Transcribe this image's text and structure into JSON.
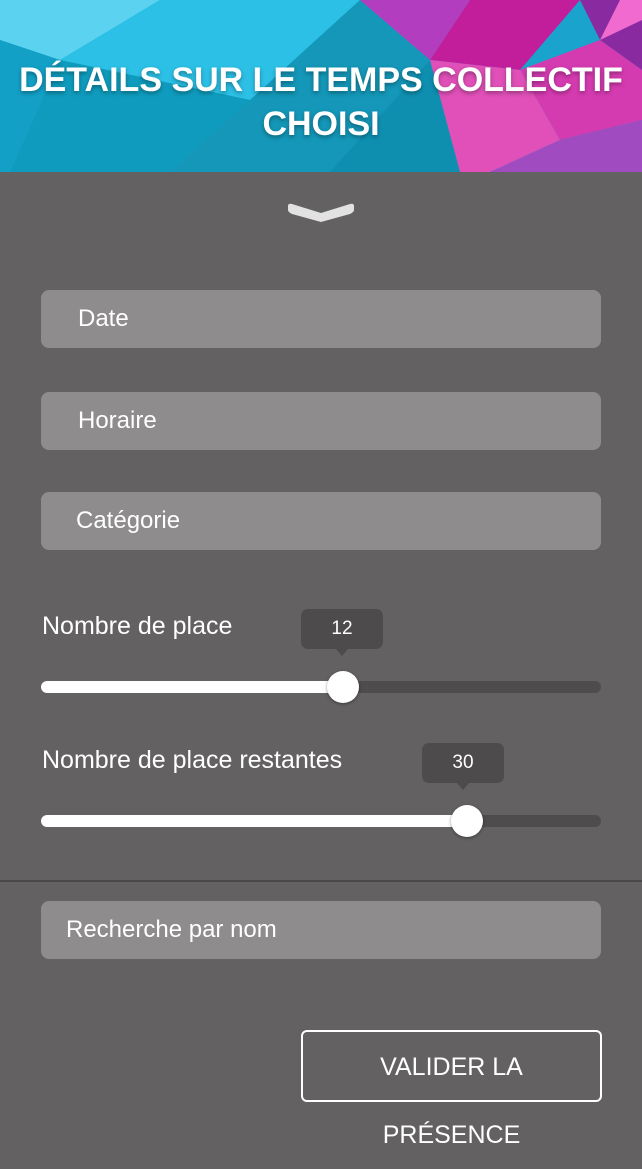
{
  "header": {
    "title_line1": "DÉTAILS SUR LE TEMPS COLLECTIF",
    "title_line2": "CHOISI"
  },
  "form": {
    "date_placeholder": "Date",
    "horaire_placeholder": "Horaire",
    "categorie_placeholder": "Catégorie",
    "search_placeholder": "Recherche par nom"
  },
  "sliders": [
    {
      "label": "Nombre de place",
      "value": "12",
      "fill_fraction": 0.54
    },
    {
      "label": "Nombre de place restantes",
      "value": "30",
      "fill_fraction": 0.76
    }
  ],
  "actions": {
    "validate_label": "VALIDER LA PRÉSENCE"
  },
  "icons": {
    "collapse": "chevron-down-icon"
  },
  "colors": {
    "panel_bg": "#636162",
    "field_bg": "#8e8c8d",
    "tooltip_bg": "#4d4b4c",
    "header_cyan": "#1fa9cf",
    "header_magenta": "#c21e9c"
  }
}
